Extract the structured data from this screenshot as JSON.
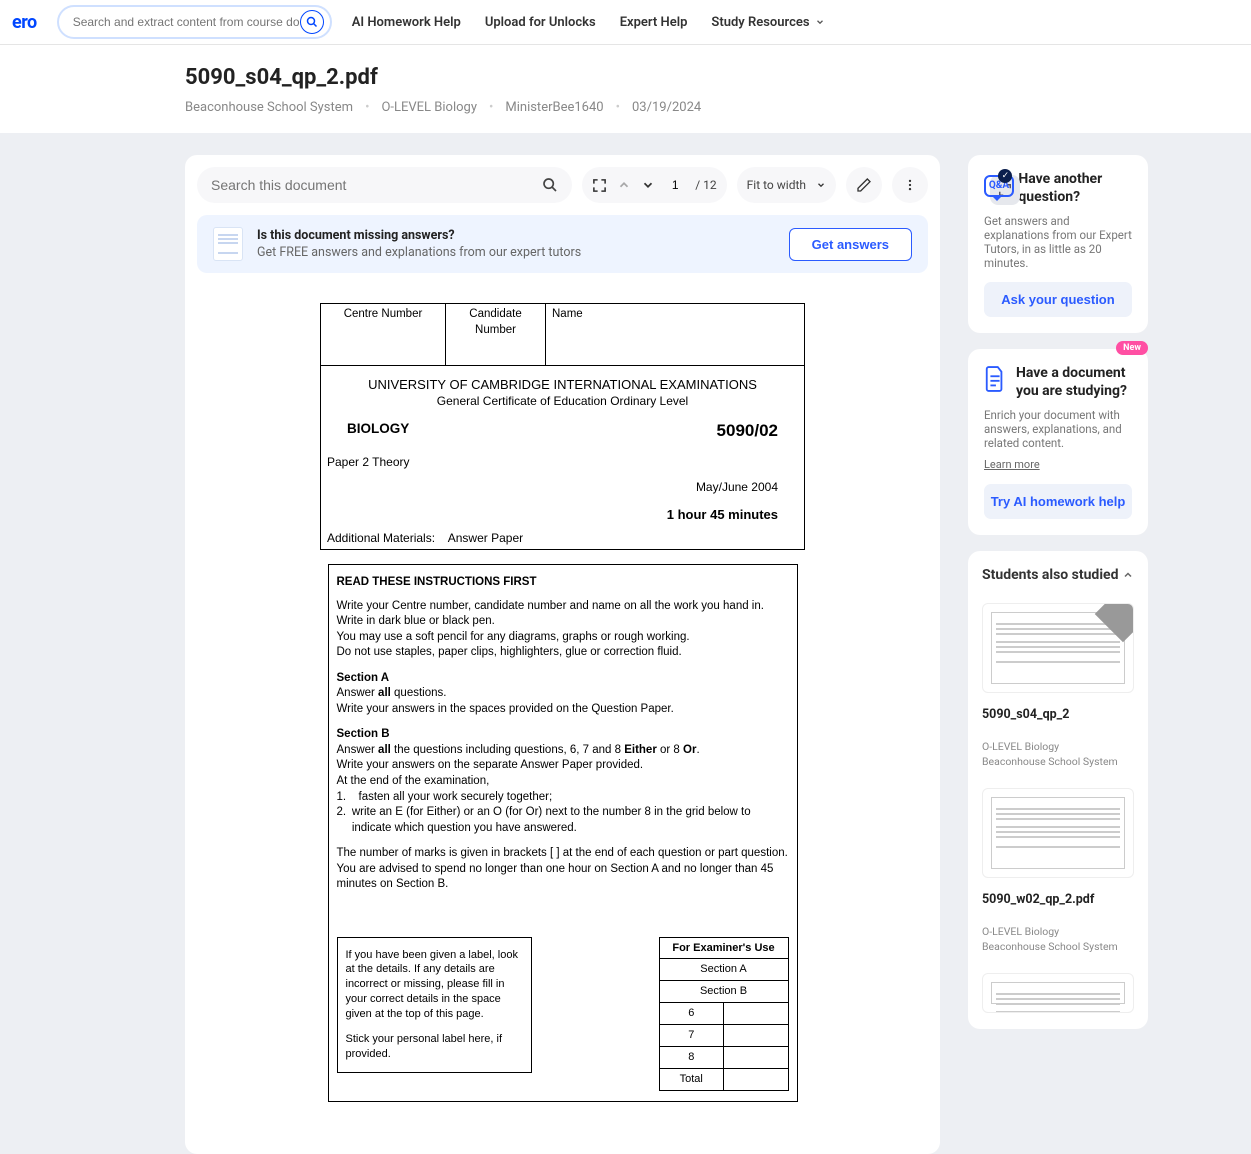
{
  "nav": {
    "logo": "ero",
    "search_placeholder": "Search and extract content from course documents,",
    "links": [
      "AI Homework Help",
      "Upload for Unlocks",
      "Expert Help",
      "Study Resources"
    ]
  },
  "header": {
    "title": "5090_s04_qp_2.pdf",
    "crumbs": [
      "Beaconhouse School System",
      "O-LEVEL Biology",
      "MinisterBee1640",
      "03/19/2024"
    ]
  },
  "viewer": {
    "search_placeholder": "Search this document",
    "page_current": "1",
    "page_total": "/ 12",
    "fit_label": "Fit to width"
  },
  "banner": {
    "title": "Is this document missing answers?",
    "sub": "Get FREE answers and explanations from our expert tutors",
    "cta": "Get answers"
  },
  "exam": {
    "h_centre": "Centre Number",
    "h_candidate": "Candidate Number",
    "h_name": "Name",
    "uni": "UNIVERSITY OF CAMBRIDGE INTERNATIONAL EXAMINATIONS",
    "gce": "General Certificate of Education Ordinary Level",
    "subject": "BIOLOGY",
    "code": "5090/02",
    "paper": "Paper 2   Theory",
    "date": "May/June 2004",
    "duration": "1 hour 45 minutes",
    "materials_label": "Additional Materials:",
    "materials_val": "Answer Paper",
    "instr_title": "READ THESE INSTRUCTIONS FIRST",
    "instr_p1": "Write your Centre number, candidate number and name on all the work you hand in.",
    "instr_p2": "Write in dark blue or black pen.",
    "instr_p3": "You may use a soft pencil for any diagrams, graphs or rough working.",
    "instr_p4": "Do not use staples, paper clips, highlighters, glue or correction fluid.",
    "secA": "Section A",
    "secA_l1_pre": "Answer ",
    "secA_l1_b": "all",
    "secA_l1_post": " questions.",
    "secA_l2": "Write your answers in the spaces provided on the Question Paper.",
    "secB": "Section B",
    "secB_l1_pre": "Answer ",
    "secB_l1_all": "all",
    "secB_l1_mid": " the questions including questions, 6, 7 and 8 ",
    "secB_l1_either": "Either",
    "secB_l1_or8": " or 8 ",
    "secB_l1_or": "Or",
    "secB_l1_end": ".",
    "secB_l2": "Write your answers on the separate Answer Paper provided.",
    "secB_l3": "At the end of the examination,",
    "secB_li1": "fasten all your work securely together;",
    "secB_li2": "write an E (for Either) or an O (for Or) next to the number 8 in the grid below to indicate which question you have answered.",
    "marks_p1": "The number of marks is given in brackets [  ] at the end of each question or part question.",
    "marks_p2": "You are advised to spend no longer than one hour on Section A and no longer than 45 minutes on Section B.",
    "label_p1": "If you have been given a label, look at the details. If any details are incorrect or missing, please fill in your correct details in the space given at the top of this page.",
    "label_p2": "Stick your personal label here, if provided.",
    "ex_head": "For Examiner's Use",
    "ex_rows": [
      "Section A",
      "Section B",
      "6",
      "7",
      "8",
      "Total"
    ]
  },
  "sidebar": {
    "qa_label": "Q&A",
    "card1_title": "Have another question?",
    "card1_body": "Get answers and explanations from our Expert Tutors, in as little as 20 minutes.",
    "card1_cta": "Ask your question",
    "new_badge": "New",
    "card2_title": "Have a document you are studying?",
    "card2_body": "Enrich your document with answers, explanations, and related content.",
    "card2_link": "Learn more",
    "card2_cta": "Try AI homework help",
    "also_title": "Students also studied",
    "also_items": [
      {
        "name": "5090_s04_qp_2",
        "sub1": "O-LEVEL Biology",
        "sub2": "Beaconhouse School System",
        "ribbon": true
      },
      {
        "name": "5090_w02_qp_2.pdf",
        "sub1": "O-LEVEL Biology",
        "sub2": "Beaconhouse School System",
        "ribbon": false
      }
    ]
  }
}
